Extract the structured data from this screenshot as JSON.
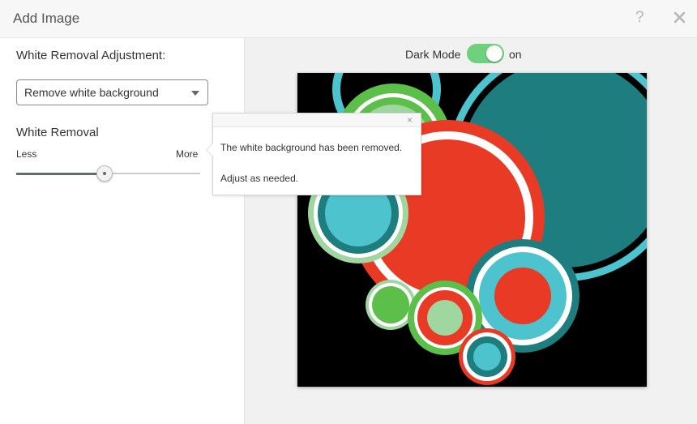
{
  "dialog": {
    "title": "Add Image",
    "help_icon": "question-mark-icon",
    "close_icon": "close-icon"
  },
  "left_panel": {
    "adjustment_label": "White Removal Adjustment:",
    "dropdown": {
      "selected": "Remove white background",
      "icon": "chevron-down-icon"
    },
    "removal_label": "White Removal",
    "slider": {
      "min_label": "Less",
      "max_label": "More",
      "value_fraction": 0.48
    }
  },
  "preview": {
    "dark_mode_label": "Dark Mode",
    "dark_mode_state": "on",
    "toggle_on": true,
    "toggle_color": "#6fd07d",
    "background_color": "#000000"
  },
  "popover": {
    "line1": "The white background has been removed.",
    "line2": "Adjust as needed.",
    "close_glyph": "×"
  },
  "colors": {
    "teal": "#1e7d7e",
    "cyan": "#4cc3cd",
    "red": "#e83a24",
    "green": "#5cbf4a",
    "light_green": "#a0d6a0",
    "white": "#ffffff"
  }
}
